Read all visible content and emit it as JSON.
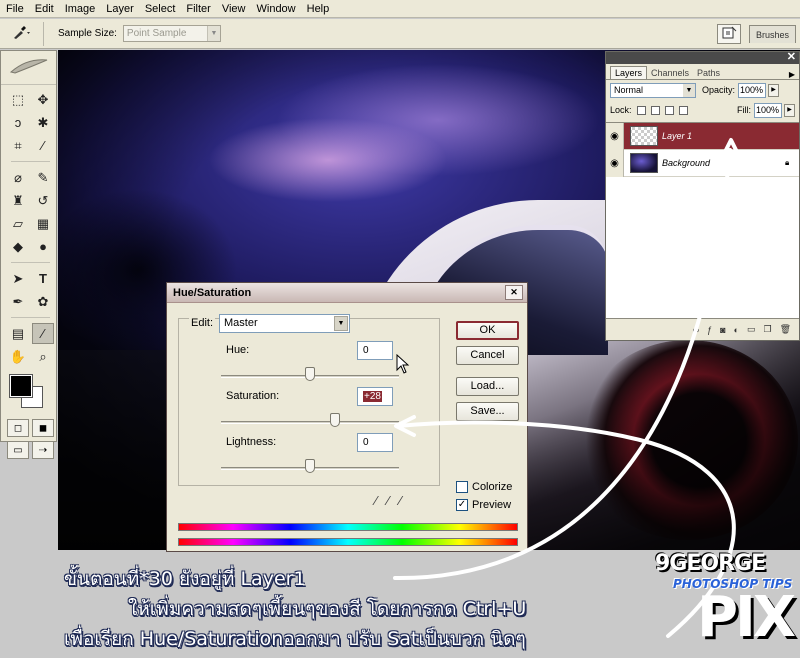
{
  "menu": [
    "File",
    "Edit",
    "Image",
    "Layer",
    "Select",
    "Filter",
    "View",
    "Window",
    "Help"
  ],
  "options_bar": {
    "sample_size_label": "Sample Size:",
    "sample_size_value": "Point Sample",
    "brushes_tab": "Brushes"
  },
  "layers_panel": {
    "tabs": [
      "Layers",
      "Channels",
      "Paths"
    ],
    "blend_mode": "Normal",
    "opacity_label": "Opacity:",
    "opacity_value": "100%",
    "lock_label": "Lock:",
    "fill_label": "Fill:",
    "fill_value": "100%",
    "layers": [
      {
        "name": "Layer 1",
        "selected": true
      },
      {
        "name": "Background",
        "locked": true
      }
    ]
  },
  "hue_saturation": {
    "title": "Hue/Saturation",
    "edit_label": "Edit:",
    "edit_value": "Master",
    "hue_label": "Hue:",
    "hue_value": "0",
    "saturation_label": "Saturation:",
    "saturation_value": "+28",
    "lightness_label": "Lightness:",
    "lightness_value": "0",
    "buttons": {
      "ok": "OK",
      "cancel": "Cancel",
      "load": "Load...",
      "save": "Save..."
    },
    "colorize_label": "Colorize",
    "colorize_checked": false,
    "preview_label": "Preview",
    "preview_checked": true
  },
  "caption": {
    "line1": "ขั้นตอนที่*30 ยังอยู่ที่ Layer1",
    "line2": "ให้เพิ่มความสดๆเพี้ยนๆของสี โดยการกด Ctrl+U",
    "line3": "เพื่อเรียก Hue/Saturationออกมา ปรับ Satเป็นบวก นิดๆ"
  },
  "logo": {
    "name": "9GEORGE",
    "tagline": "PHOTOSHOP TIPS",
    "mark": "PIX"
  },
  "colors": {
    "selection_red": "#8a2a32",
    "ui_gray": "#ece9d8",
    "caption_outline": "#1f2a55"
  }
}
